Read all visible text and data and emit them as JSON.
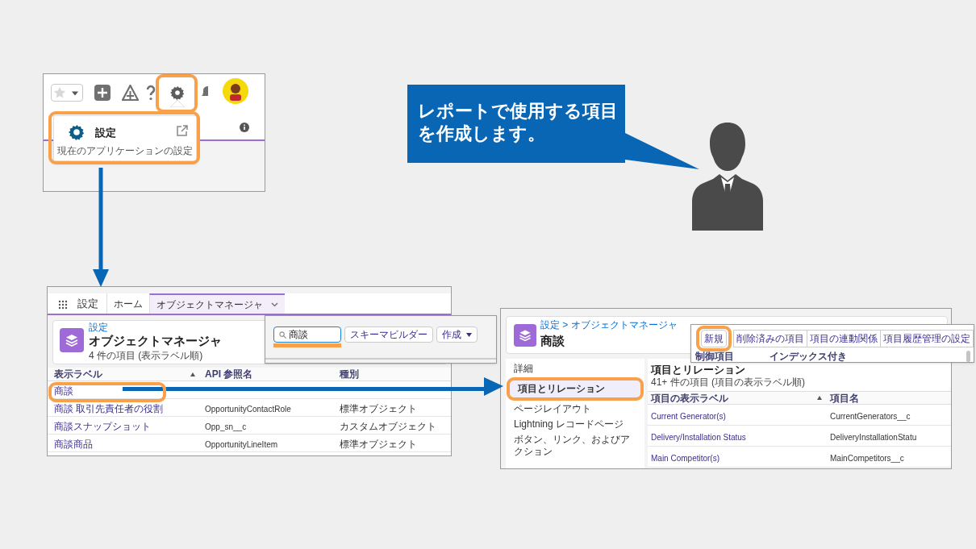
{
  "settings_menu_shot": {
    "menu_item": {
      "label": "設定",
      "description": "現在のアプリケーションの設定"
    }
  },
  "callout": {
    "lines": [
      "レポートで使用する項目",
      "を作成します。"
    ]
  },
  "object_manager_shot": {
    "app_name": "設定",
    "tabs": [
      {
        "label": "ホーム",
        "selected": false
      },
      {
        "label": "オブジェクトマネージャ",
        "selected": true
      }
    ],
    "breadcrumb": "設定",
    "title": "オブジェクトマネージャ",
    "summary": "4 件の項目 (表示ラベル順)",
    "columns": [
      "表示ラベル",
      "API 参照名",
      "種別"
    ],
    "rows": [
      {
        "label": "商談"
      },
      {
        "label": "商談 取引先責任者の役割",
        "api_name": "OpportunityContactRole",
        "type": "標準オブジェクト"
      },
      {
        "label": "商談スナップショット",
        "api_name": "Opp_sn__c",
        "type": "カスタムオブジェクト"
      },
      {
        "label": "商談商品",
        "api_name": "OpportunityLineItem",
        "type": "標準オブジェクト"
      }
    ],
    "search": {
      "value": "商談"
    },
    "buttons": [
      "スキーマビルダー",
      "作成"
    ]
  },
  "object_detail_shot": {
    "breadcrumb": "設定 > オブジェクトマネージャ",
    "title": "商談",
    "nav": [
      {
        "label": "詳細",
        "selected": false
      },
      {
        "label": "項目とリレーション",
        "selected": true
      },
      {
        "label": "ページレイアウト",
        "selected": false
      },
      {
        "label": "Lightning レコードページ",
        "selected": false
      },
      {
        "label": "ボタン、リンク、およびアクション",
        "selected": false
      }
    ],
    "section_title": "項目とリレーション",
    "summary": "41+ 件の項目 (項目の表示ラベル順)",
    "columns": [
      "項目の表示ラベル",
      "項目名"
    ],
    "rows": [
      {
        "label": "Current Generator(s)",
        "name": "CurrentGenerators__c"
      },
      {
        "label": "Delivery/Installation Status",
        "name": "DeliveryInstallationStatu"
      },
      {
        "label": "Main Competitor(s)",
        "name": "MainCompetitors__c"
      }
    ],
    "toolbar_buttons": [
      "新規",
      "削除済みの項目",
      "項目の連動関係",
      "項目履歴管理の設定"
    ],
    "toolbar_columns": [
      "制御項目",
      "インデックス付き"
    ]
  }
}
